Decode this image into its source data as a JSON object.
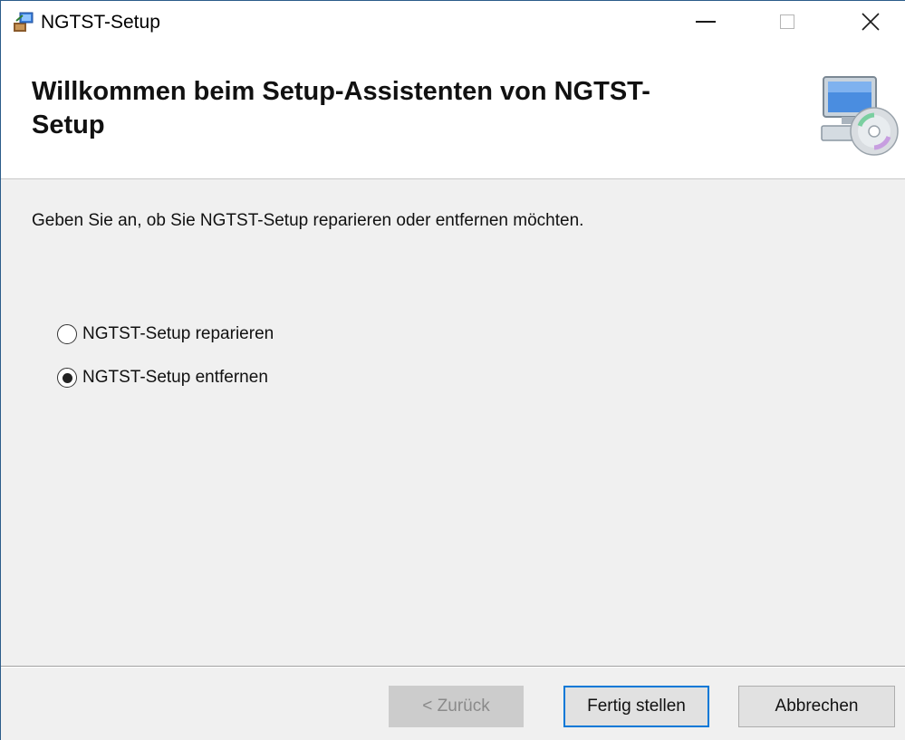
{
  "window": {
    "title": "NGTST-Setup",
    "title_icon": "installer-icon",
    "controls": {
      "minimize": "minimize-icon",
      "maximize": "maximize-icon",
      "close": "close-icon"
    }
  },
  "header": {
    "title": "Willkommen beim Setup-Assistenten von NGTST-Setup",
    "icon": "computer-cd-icon"
  },
  "body": {
    "instruction": "Geben Sie an, ob Sie NGTST-Setup reparieren oder entfernen möchten.",
    "options": [
      {
        "label": "NGTST-Setup reparieren",
        "selected": false
      },
      {
        "label": "NGTST-Setup entfernen",
        "selected": true
      }
    ]
  },
  "footer": {
    "back_label": "< Zurück",
    "back_enabled": false,
    "finish_label": "Fertig stellen",
    "cancel_label": "Abbrechen"
  },
  "colors": {
    "focus_border": "#0078d7",
    "window_border": "#2b5c8a",
    "dialog_bg": "#f0f0f0"
  }
}
